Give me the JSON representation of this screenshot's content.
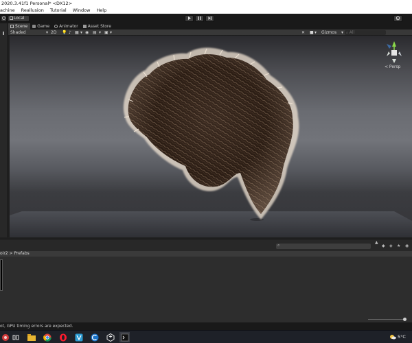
{
  "window": {
    "title": "2020.3.41f1 Personal* <DX12>"
  },
  "menu": [
    "achine",
    "Reallusion",
    "Tutorial",
    "Window",
    "Help"
  ],
  "toolbar": {
    "local_label": "Local"
  },
  "tabs": [
    {
      "label": "Scene",
      "icon": "scene-grid-icon",
      "active": true
    },
    {
      "label": "Game",
      "icon": "game-controller-icon",
      "active": false
    },
    {
      "label": "Animator",
      "icon": "animator-icon",
      "active": false
    },
    {
      "label": "Asset Store",
      "icon": "store-bag-icon",
      "active": false
    }
  ],
  "scene_toolbar": {
    "shading_mode": "Shaded",
    "mode_2d": "2D",
    "gizmos_label": "Gizmos",
    "search_placeholder": "All"
  },
  "scene_gizmo": {
    "projection_label": "< Persp",
    "axes": [
      "y",
      "x",
      "z"
    ]
  },
  "project": {
    "breadcrumb_parent": "oir2",
    "breadcrumb_current": "Prefabs"
  },
  "status": {
    "message": "ot, GPU timing errors are expected."
  },
  "taskbar": {
    "temperature": "5°C",
    "icons": [
      "search-icon",
      "task-view-icon",
      "file-explorer-icon",
      "chrome-icon",
      "opera-icon",
      "vivaldi-icon",
      "unity-hub-icon",
      "unity-editor-icon",
      "terminal-icon"
    ]
  },
  "colors": {
    "editor_dark": "#191919",
    "panel": "#282828",
    "active_tab": "#3c3c3c",
    "accent_blue": "#3d6ca5",
    "hair_dark": "#2b1d14",
    "hair_light": "#e9d9c6"
  }
}
